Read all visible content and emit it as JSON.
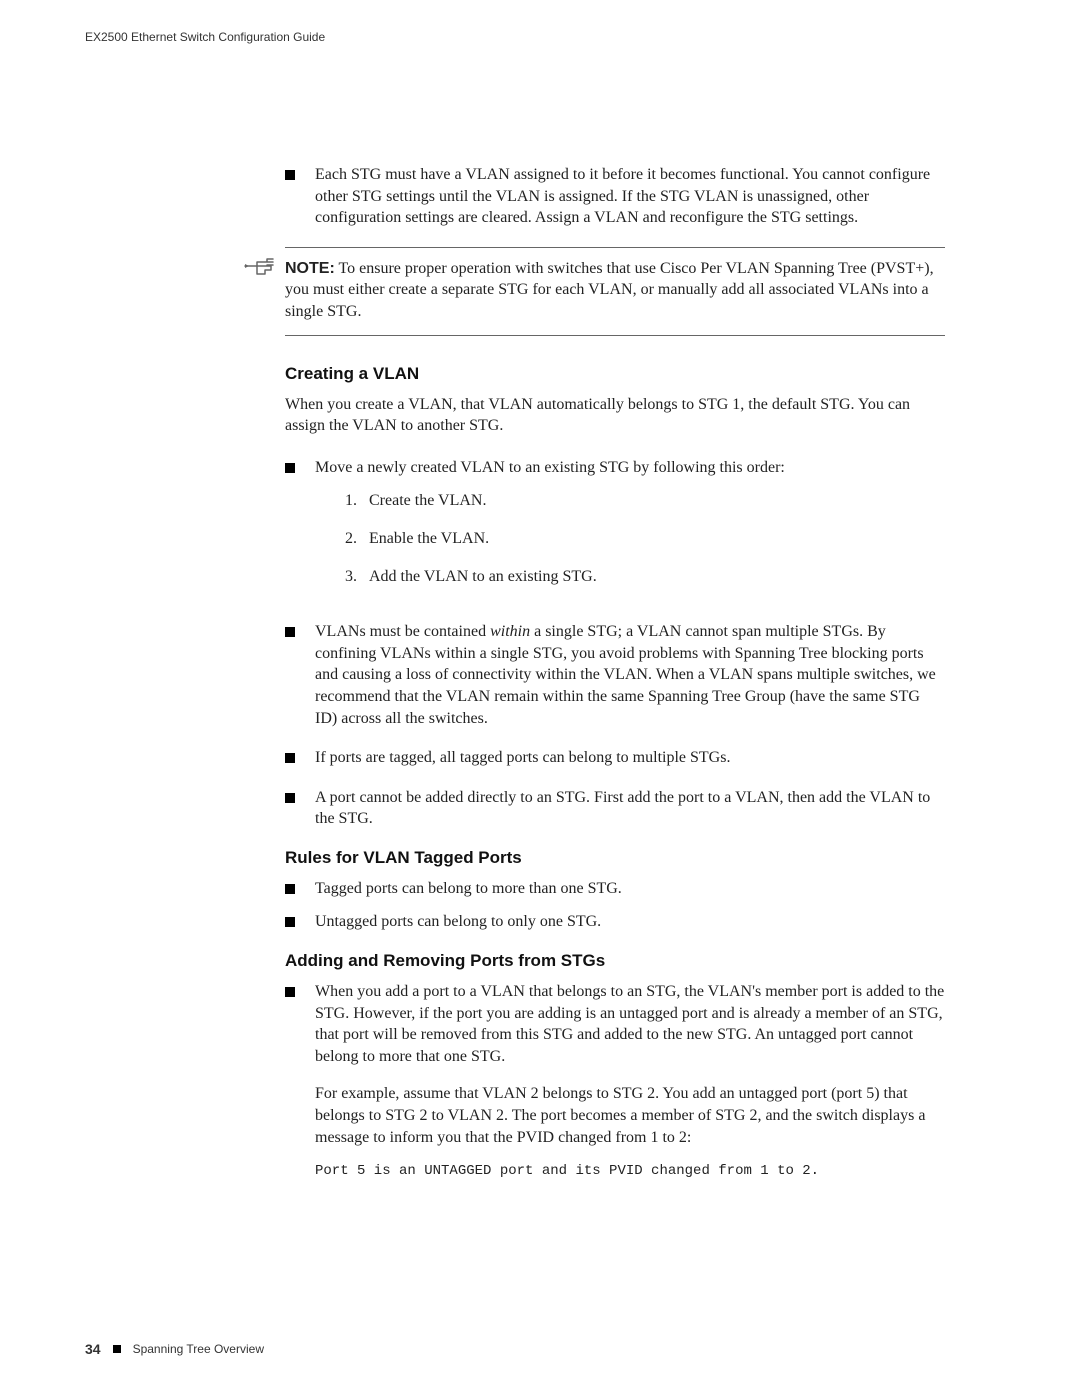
{
  "header": {
    "title": "EX2500 Ethernet Switch Configuration Guide"
  },
  "intro_bullet": "Each STG must have a VLAN assigned to it before it becomes functional. You cannot configure other STG settings until the VLAN is assigned. If the STG VLAN is unassigned, other configuration settings are cleared. Assign a VLAN and reconfigure the STG settings.",
  "note": {
    "label": "NOTE:",
    "text": " To ensure proper operation with switches that use Cisco Per VLAN Spanning Tree (PVST+), you must either create a separate STG for each VLAN, or manually add all associated VLANs into a single STG."
  },
  "section1": {
    "heading": "Creating a VLAN",
    "para": "When you create a VLAN, that VLAN automatically belongs to STG 1, the default STG. You can assign the VLAN to another STG.",
    "bullet1_intro": "Move a newly created VLAN to an existing STG by following this order:",
    "steps": [
      "Create the VLAN.",
      "Enable the VLAN.",
      "Add the VLAN to an existing STG."
    ],
    "bullet2_pre": "VLANs must be contained ",
    "bullet2_italic": "within",
    "bullet2_post": " a single STG; a VLAN cannot span multiple STGs. By confining VLANs within a single STG, you avoid problems with Spanning Tree blocking ports and causing a loss of connectivity within the VLAN. When a VLAN spans multiple switches, we recommend that the VLAN remain within the same Spanning Tree Group (have the same STG ID) across all the switches.",
    "bullet3": "If ports are tagged, all tagged ports can belong to multiple STGs.",
    "bullet4": "A port cannot be added directly to an STG. First add the port to a VLAN, then add the VLAN to the STG."
  },
  "section2": {
    "heading": "Rules for VLAN Tagged Ports",
    "bullet1": "Tagged ports can belong to more than one STG.",
    "bullet2": "Untagged ports can belong to only one STG."
  },
  "section3": {
    "heading": "Adding and Removing Ports from STGs",
    "bullet1_p1": "When you add a port to a VLAN that belongs to an STG, the VLAN's member port is added to the STG. However, if the port you are adding is an untagged port and is already a member of an STG, that port will be removed from this STG and added to the new STG. An untagged port cannot belong to more that one STG.",
    "bullet1_p2": "For example, assume that VLAN 2 belongs to STG 2. You add an untagged port (port 5) that belongs to STG 2 to VLAN 2. The port becomes a member of STG 2, and the switch displays a message to inform you that the PVID changed from 1 to 2:",
    "code": "Port 5 is an UNTAGGED port and its PVID changed from 1 to 2."
  },
  "footer": {
    "page_number": "34",
    "section": "Spanning Tree Overview"
  }
}
